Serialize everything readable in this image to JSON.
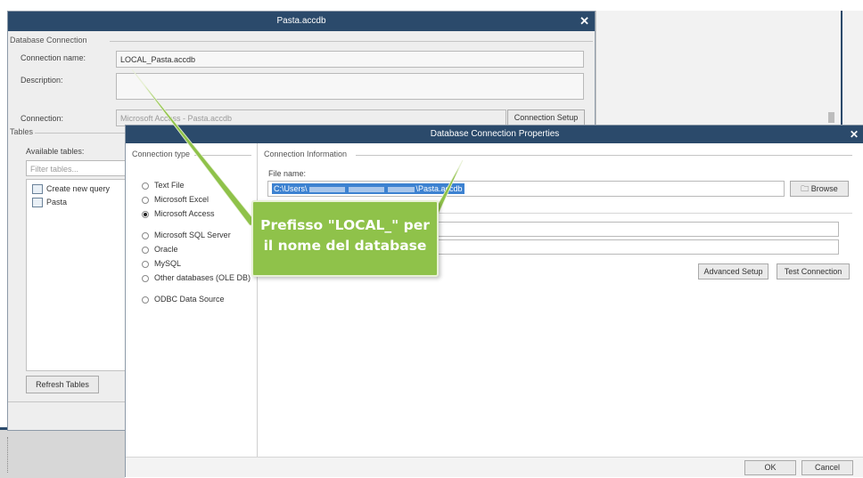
{
  "dialog1": {
    "title": "Pasta.accdb",
    "group_db": "Database Connection",
    "connection_name_label": "Connection name:",
    "connection_name_value": "LOCAL_Pasta.accdb",
    "description_label": "Description:",
    "connection_label": "Connection:",
    "connection_value": "Microsoft Access - Pasta.accdb",
    "connection_setup_button": "Connection Setup",
    "group_tables": "Tables",
    "available_tables_label": "Available tables:",
    "filter_placeholder": "Filter tables...",
    "tables": [
      "Create new query",
      "Pasta"
    ],
    "refresh_button": "Refresh Tables"
  },
  "dialog2": {
    "title": "Database Connection Properties",
    "connection_type_header": "Connection type",
    "types": [
      {
        "label": "Text File",
        "selected": false
      },
      {
        "label": "Microsoft Excel",
        "selected": false
      },
      {
        "label": "Microsoft Access",
        "selected": true
      },
      {
        "label": "Microsoft SQL Server",
        "selected": false
      },
      {
        "label": "Oracle",
        "selected": false
      },
      {
        "label": "MySQL",
        "selected": false
      },
      {
        "label": "Other databases (OLE DB)",
        "selected": false
      },
      {
        "label": "ODBC Data Source",
        "selected": false
      }
    ],
    "connection_info_header": "Connection Information",
    "file_name_label": "File name:",
    "file_name_start": "C:\\Users\\",
    "file_name_end": "\\Pasta.accdb",
    "browse_button": "Browse",
    "advanced_setup_button": "Advanced Setup",
    "test_connection_button": "Test Connection",
    "ok_button": "OK",
    "cancel_button": "Cancel"
  },
  "callout": {
    "line1": "Prefisso \"LOCAL_\" per",
    "line2": "il nome del database",
    "color": "#8fc24a"
  }
}
